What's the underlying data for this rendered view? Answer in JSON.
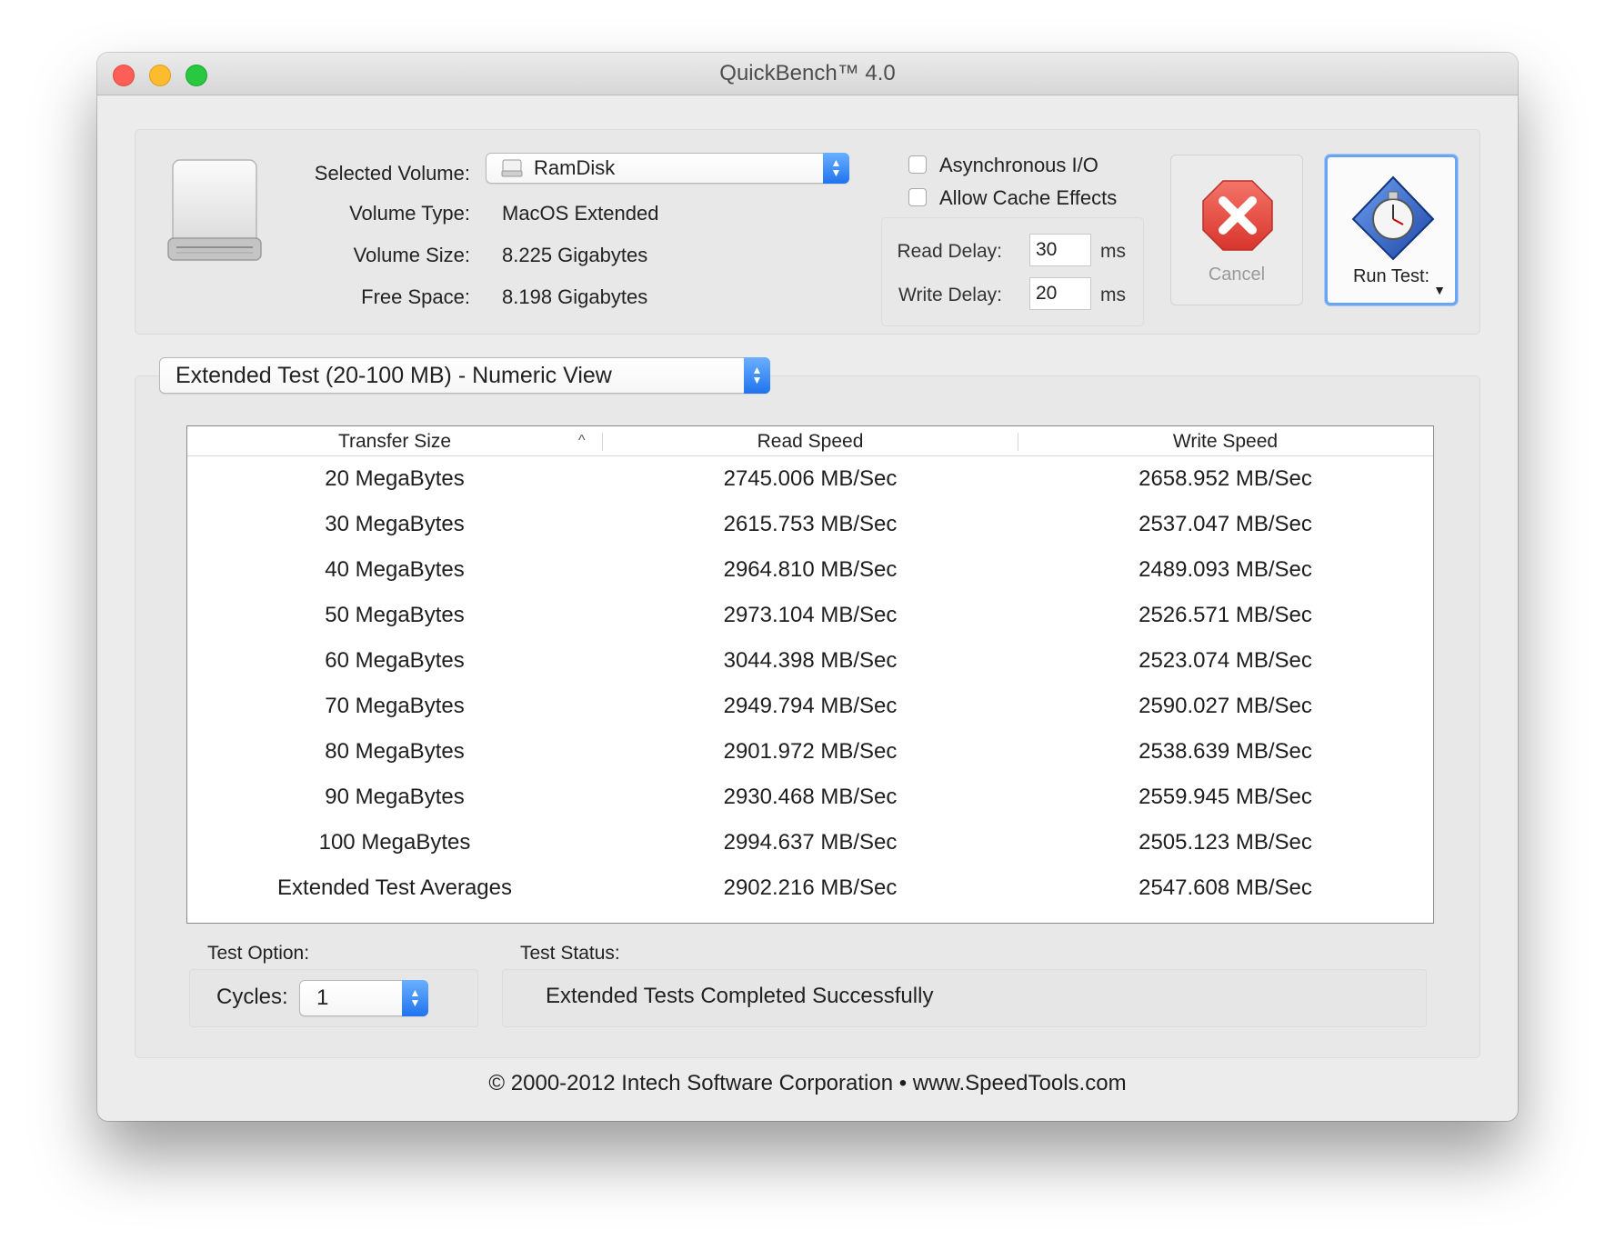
{
  "window": {
    "title": "QuickBench™ 4.0"
  },
  "volume": {
    "selected_label": "Selected Volume:",
    "selected_value": "RamDisk",
    "type_label": "Volume Type:",
    "type_value": "MacOS Extended",
    "size_label": "Volume Size:",
    "size_value": "8.225 Gigabytes",
    "free_label": "Free Space:",
    "free_value": "8.198 Gigabytes"
  },
  "options": {
    "async_label": "Asynchronous I/O",
    "async_checked": false,
    "cache_label": "Allow Cache Effects",
    "cache_checked": false,
    "read_delay_label": "Read Delay:",
    "read_delay_value": "30",
    "write_delay_label": "Write Delay:",
    "write_delay_value": "20",
    "unit": "ms"
  },
  "buttons": {
    "cancel_label": "Cancel",
    "run_label": "Run Test:"
  },
  "view_selector": {
    "value": "Extended Test (20-100 MB) - Numeric View"
  },
  "table": {
    "columns": [
      "Transfer Size",
      "Read Speed",
      "Write Speed"
    ],
    "rows": [
      [
        "20 MegaBytes",
        "2745.006 MB/Sec",
        "2658.952 MB/Sec"
      ],
      [
        "30 MegaBytes",
        "2615.753 MB/Sec",
        "2537.047 MB/Sec"
      ],
      [
        "40 MegaBytes",
        "2964.810 MB/Sec",
        "2489.093 MB/Sec"
      ],
      [
        "50 MegaBytes",
        "2973.104 MB/Sec",
        "2526.571 MB/Sec"
      ],
      [
        "60 MegaBytes",
        "3044.398 MB/Sec",
        "2523.074 MB/Sec"
      ],
      [
        "70 MegaBytes",
        "2949.794 MB/Sec",
        "2590.027 MB/Sec"
      ],
      [
        "80 MegaBytes",
        "2901.972 MB/Sec",
        "2538.639 MB/Sec"
      ],
      [
        "90 MegaBytes",
        "2930.468 MB/Sec",
        "2559.945 MB/Sec"
      ],
      [
        "100 MegaBytes",
        "2994.637 MB/Sec",
        "2505.123 MB/Sec"
      ],
      [
        "Extended Test Averages",
        "2902.216 MB/Sec",
        "2547.608 MB/Sec"
      ]
    ]
  },
  "test_option": {
    "label": "Test Option:",
    "cycles_label": "Cycles:",
    "cycles_value": "1"
  },
  "test_status": {
    "label": "Test Status:",
    "value": "Extended Tests Completed Successfully"
  },
  "footer": {
    "text": "© 2000-2012 Intech Software Corporation • www.SpeedTools.com"
  },
  "colors": {
    "accent": "#1f73ee",
    "cancel_red": "#e8443a",
    "run_blue": "#2d5fc0"
  },
  "icons": [
    "drive-icon",
    "cancel-x-icon",
    "stopwatch-icon",
    "sort-ascending-icon",
    "stepper-arrows-icon",
    "dropdown-arrow-icon"
  ]
}
